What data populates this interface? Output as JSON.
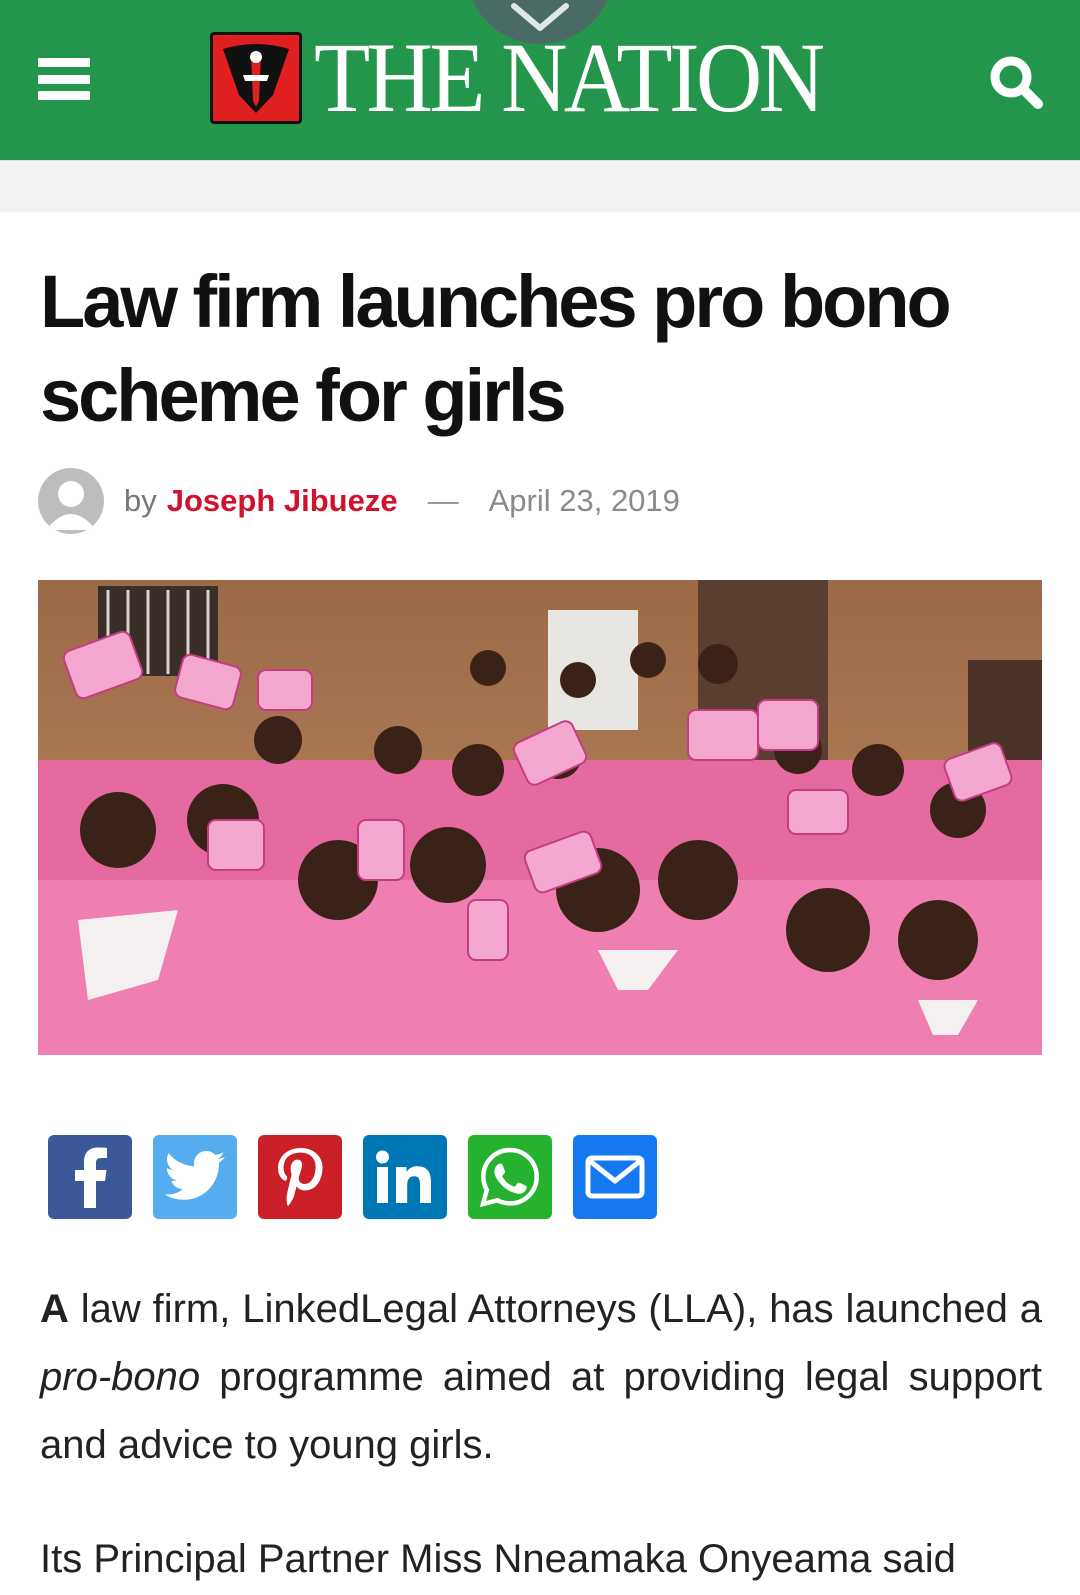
{
  "header": {
    "brand": "THE NATION",
    "colors": {
      "bar": "#24964c",
      "logo_red": "#e02020"
    },
    "menu_icon": "hamburger-icon",
    "search_icon": "search-icon",
    "pull_tab_icon": "chevron-down-icon"
  },
  "article": {
    "headline": "Law firm launches pro bono scheme for girls",
    "byline": {
      "prefix": "by",
      "author": "Joseph Jibueze",
      "separator": "—",
      "date": "April 23, 2019"
    },
    "share_buttons": [
      {
        "name": "facebook",
        "color": "#3b5998"
      },
      {
        "name": "twitter",
        "color": "#55acee"
      },
      {
        "name": "pinterest",
        "color": "#cb2027"
      },
      {
        "name": "linkedin",
        "color": "#0077b5"
      },
      {
        "name": "whatsapp",
        "color": "#25b22e"
      },
      {
        "name": "email",
        "color": "#1478f0"
      }
    ],
    "paragraph1": {
      "lead": "A",
      "part1": " law firm, LinkedLegal Attorneys  (LLA), has launched a ",
      "italic": "pro-bono",
      "part2": " programme aimed at providing legal support and advice to young girls."
    },
    "paragraph2": "Its Principal Partner Miss Nneamaka Onyeama said"
  }
}
